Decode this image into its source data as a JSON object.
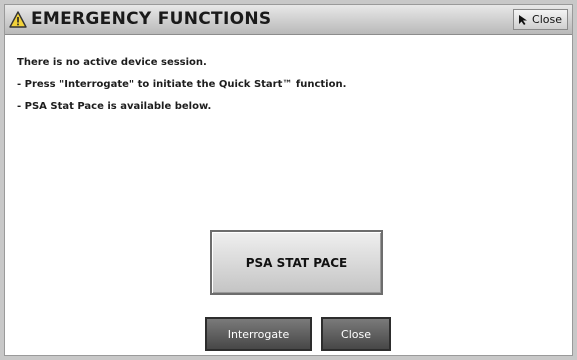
{
  "window": {
    "title": "EMERGENCY FUNCTIONS",
    "close_button_label": "Close"
  },
  "messages": [
    "There is no active device session.",
    "- Press \"Interrogate\" to initiate the Quick Start™ function.",
    "- PSA Stat Pace is available below."
  ],
  "buttons": {
    "psa_stat_pace": "PSA STAT PACE",
    "interrogate": "Interrogate",
    "close": "Close"
  },
  "icons": {
    "title": "warning-triangle-icon",
    "close": "cursor-arrow-icon"
  },
  "colors": {
    "titlebar": "#c4c4c4",
    "dialog_background": "#ffffff",
    "dark_button": "#555555",
    "psa_button": "#d8d8d8"
  }
}
